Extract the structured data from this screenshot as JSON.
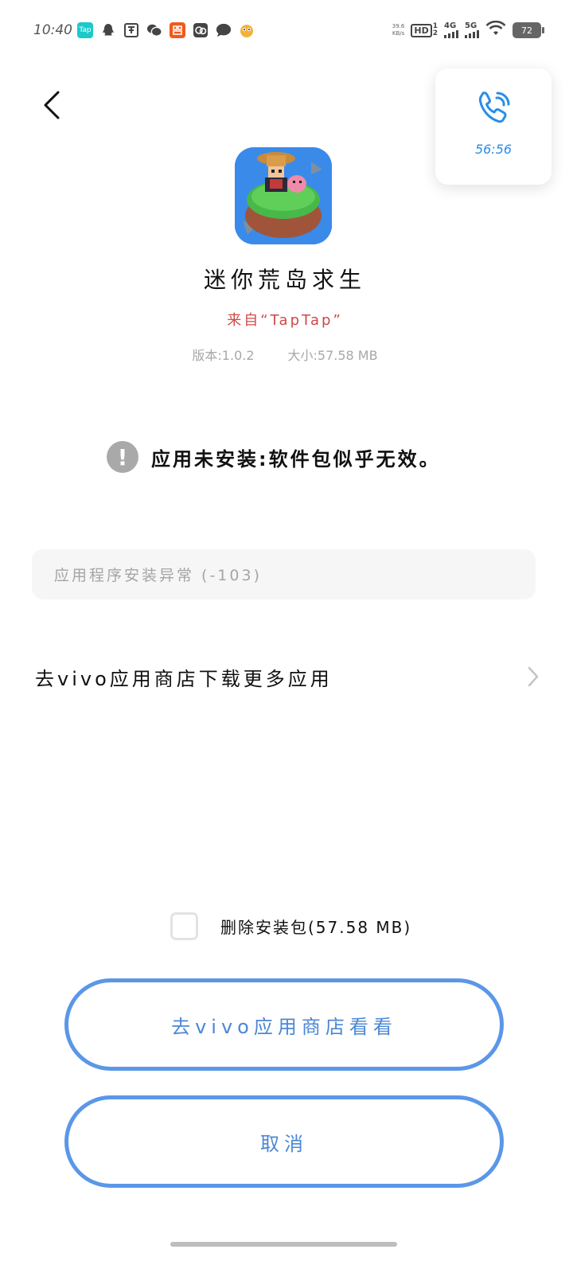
{
  "status_bar": {
    "time": "10:40",
    "speed_value": "39.6",
    "speed_unit": "KB/s",
    "hd_label": "HD",
    "sim1": "1",
    "sim2": "2",
    "net1": "4G",
    "net2": "5G",
    "battery": "72",
    "tap_icon_label": "Tap",
    "icons": [
      "taptap-icon",
      "qq-icon",
      "tuan-icon",
      "wechat-icon",
      "taobao-icon",
      "cloud-icon",
      "message-icon",
      "bird-icon"
    ]
  },
  "call_widget": {
    "duration": "56:56"
  },
  "app": {
    "name": "迷你荒岛求生",
    "source": "来自“TapTap”",
    "version": "版本:1.0.2",
    "size": "大小:57.58 MB"
  },
  "error": {
    "message": "应用未安装:软件包似乎无效。",
    "code": "应用程序安装异常 (-103)"
  },
  "store_link": {
    "label": "去vivo应用商店下载更多应用"
  },
  "delete_option": {
    "label": "删除安装包(57.58 MB)",
    "checked": false
  },
  "buttons": {
    "primary": "去vivo应用商店看看",
    "cancel": "取消"
  },
  "colors": {
    "accent": "#5b97e8",
    "source_red": "#d04848",
    "call_blue": "#2a8de6"
  }
}
